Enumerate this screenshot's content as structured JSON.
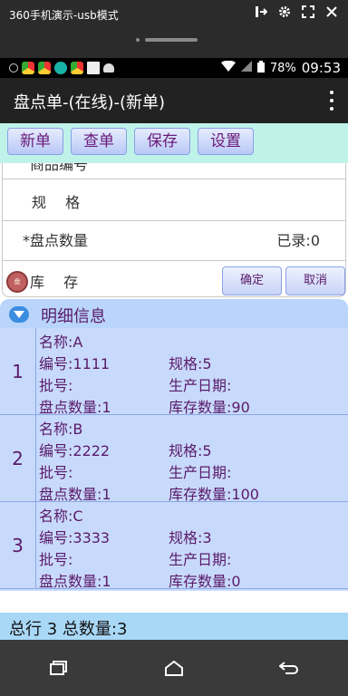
{
  "mirror": {
    "title": "360手机演示-usb模式",
    "icons": [
      "exit-icon",
      "gear-icon",
      "fullscreen-icon",
      "close-icon"
    ]
  },
  "status": {
    "battery": "78%",
    "time": "09:53"
  },
  "app_bar": {
    "title": "盘点单-(在线)-(新单)"
  },
  "toolbar": {
    "new_label": "新单",
    "query_label": "查单",
    "save_label": "保存",
    "settings_label": "设置"
  },
  "form": {
    "code_label": "商品编号",
    "spec_label": "规　 格",
    "count_label": "*盘点数量",
    "recorded": "已录:0",
    "stock_label": "库　 存",
    "confirm_label": "确定",
    "cancel_label": "取消"
  },
  "detail": {
    "title": "明细信息"
  },
  "items": [
    {
      "index": "1",
      "name": "名称:A",
      "code": "编号:1111",
      "spec": "规格:5",
      "batch": "批号:",
      "date": "生产日期:",
      "count": "盘点数量:1",
      "stock": "库存数量:90"
    },
    {
      "index": "2",
      "name": "名称:B",
      "code": "编号:2222",
      "spec": "规格:5",
      "batch": "批号:",
      "date": "生产日期:",
      "count": "盘点数量:1",
      "stock": "库存数量:100"
    },
    {
      "index": "3",
      "name": "名称:C",
      "code": "编号:3333",
      "spec": "规格:3",
      "batch": "批号:",
      "date": "生产日期:",
      "count": "盘点数量:1",
      "stock": "库存数量:0"
    }
  ],
  "footer": {
    "summary": "总行  3 总数量:3"
  },
  "colors": {
    "toolbar_bg": "#bff3ea",
    "list_bg": "#c8dafc",
    "accent_text": "#5a1a6a"
  }
}
